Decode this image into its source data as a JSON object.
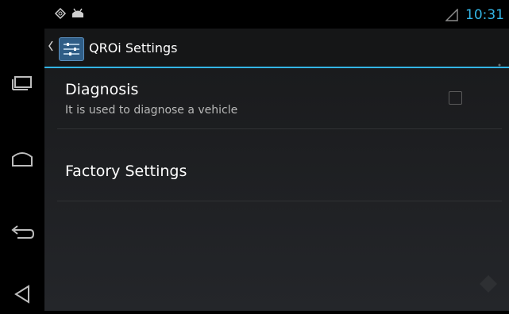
{
  "status_bar": {
    "time": "10:31",
    "icons": [
      "gps-icon",
      "android-icon",
      "signal-icon"
    ]
  },
  "action_bar": {
    "title": "QROi Settings",
    "icons": [
      "up-caret-icon",
      "settings-app-icon",
      "overflow-menu-icon"
    ]
  },
  "preferences": [
    {
      "title": "Diagnosis",
      "summary": "It is used to diagnose a vehicle",
      "checked": false
    },
    {
      "title": "Factory Settings"
    }
  ],
  "nav_bar": {
    "buttons": [
      "recent-apps-icon",
      "home-icon",
      "back-icon",
      "volume-icon"
    ]
  },
  "colors": {
    "accent": "#33b5e5",
    "background": "#1d1e20",
    "text_primary": "#ffffff",
    "text_secondary": "#b8b8b8"
  }
}
